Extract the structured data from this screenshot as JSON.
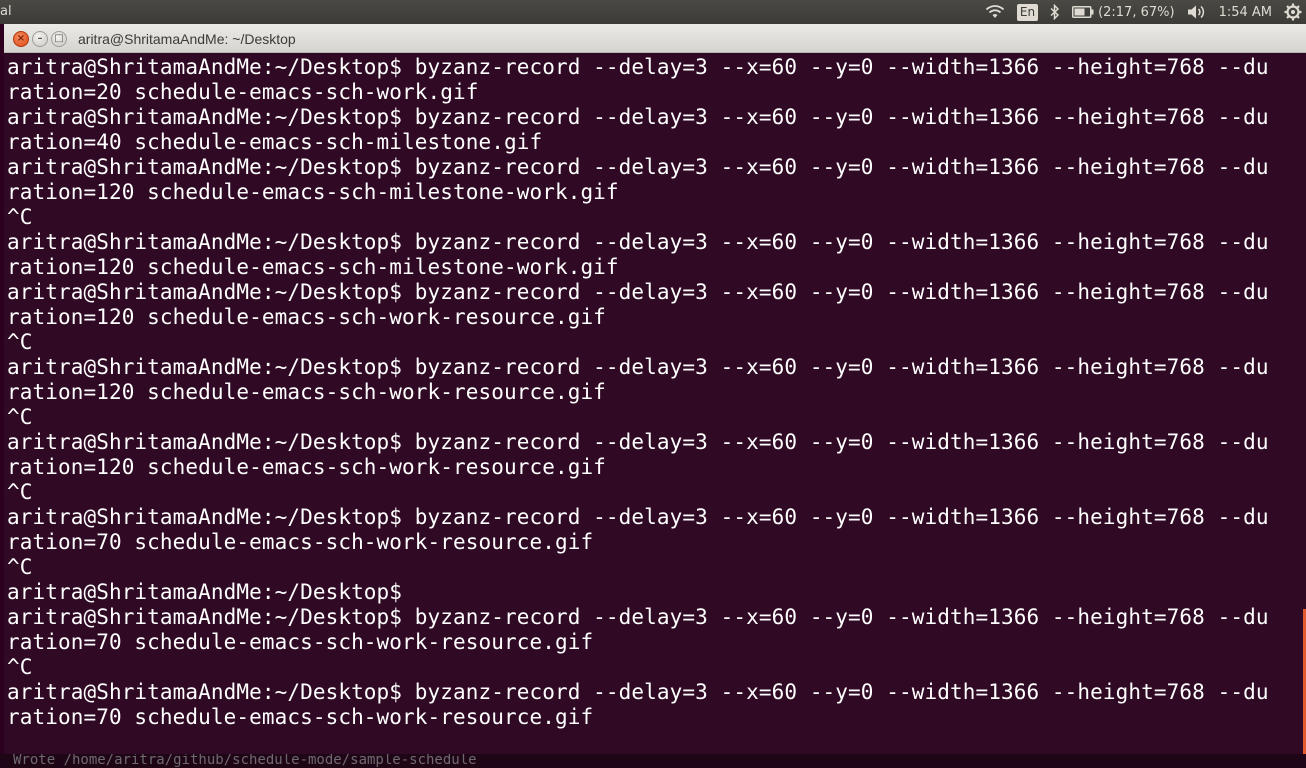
{
  "top_panel": {
    "app_name_fragment": "al",
    "keyboard_layout": "En",
    "battery_status": "(2:17, 67%)",
    "clock": "1:54 AM",
    "icons": [
      "wifi-icon",
      "bluetooth-icon",
      "battery-icon",
      "volume-icon",
      "gear-icon"
    ]
  },
  "window": {
    "title": "aritra@ShritamaAndMe: ~/Desktop",
    "close_symbol": "×",
    "minimize_symbol": "–",
    "maximize_symbol": "□"
  },
  "terminal": {
    "background": "#300a24",
    "foreground": "#ffffff",
    "text": "aritra@ShritamaAndMe:~/Desktop$ byzanz-record --delay=3 --x=60 --y=0 --width=1366 --height=768 --du\nration=20 schedule-emacs-sch-work.gif\naritra@ShritamaAndMe:~/Desktop$ byzanz-record --delay=3 --x=60 --y=0 --width=1366 --height=768 --du\nration=40 schedule-emacs-sch-milestone.gif\naritra@ShritamaAndMe:~/Desktop$ byzanz-record --delay=3 --x=60 --y=0 --width=1366 --height=768 --du\nration=120 schedule-emacs-sch-milestone-work.gif\n^C\naritra@ShritamaAndMe:~/Desktop$ byzanz-record --delay=3 --x=60 --y=0 --width=1366 --height=768 --du\nration=120 schedule-emacs-sch-milestone-work.gif\naritra@ShritamaAndMe:~/Desktop$ byzanz-record --delay=3 --x=60 --y=0 --width=1366 --height=768 --du\nration=120 schedule-emacs-sch-work-resource.gif\n^C\naritra@ShritamaAndMe:~/Desktop$ byzanz-record --delay=3 --x=60 --y=0 --width=1366 --height=768 --du\nration=120 schedule-emacs-sch-work-resource.gif\n^C\naritra@ShritamaAndMe:~/Desktop$ byzanz-record --delay=3 --x=60 --y=0 --width=1366 --height=768 --du\nration=120 schedule-emacs-sch-work-resource.gif\n^C\naritra@ShritamaAndMe:~/Desktop$ byzanz-record --delay=3 --x=60 --y=0 --width=1366 --height=768 --du\nration=70 schedule-emacs-sch-work-resource.gif\n^C\naritra@ShritamaAndMe:~/Desktop$\naritra@ShritamaAndMe:~/Desktop$ byzanz-record --delay=3 --x=60 --y=0 --width=1366 --height=768 --du\nration=70 schedule-emacs-sch-work-resource.gif\n^C\naritra@ShritamaAndMe:~/Desktop$ byzanz-record --delay=3 --x=60 --y=0 --width=1366 --height=768 --du\nration=70 schedule-emacs-sch-work-resource.gif"
  },
  "status_line": {
    "text": "Wrote /home/aritra/github/schedule-mode/sample-schedule"
  }
}
